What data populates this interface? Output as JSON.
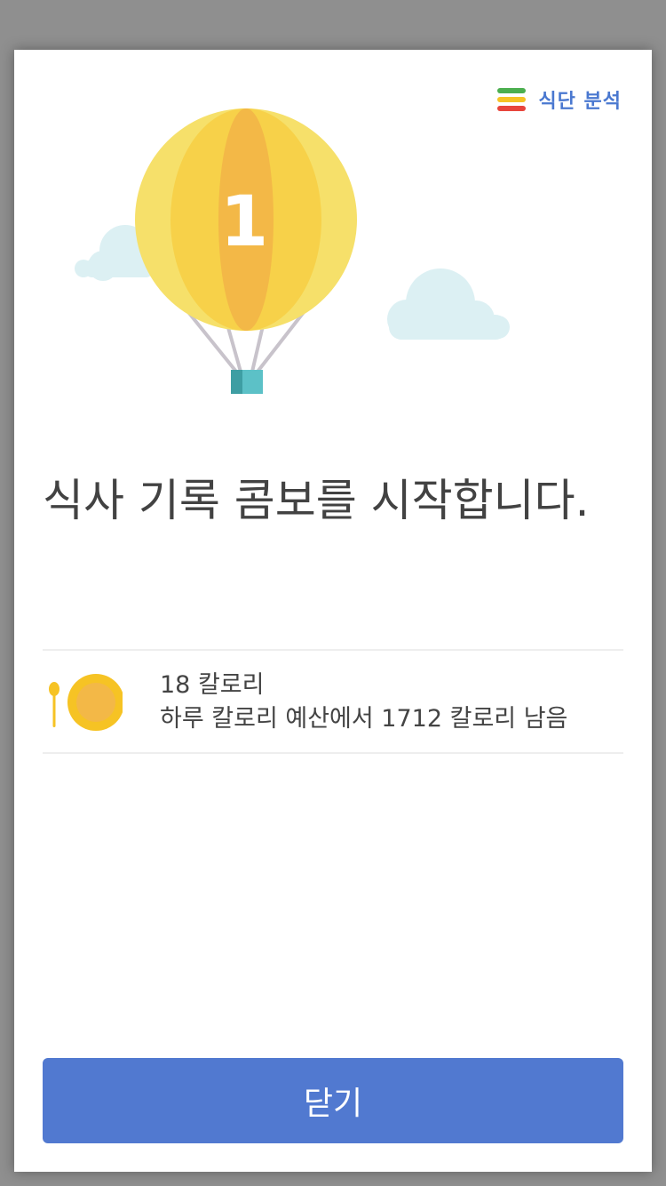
{
  "header": {
    "diet_link_label": "식단 분석",
    "diet_icon_colors": [
      "#4caf50",
      "#f6c324",
      "#e8453c"
    ]
  },
  "balloon": {
    "streak_number": "1"
  },
  "headline": "식사 기록 콤보를 시작합니다.",
  "summary": {
    "calories_line": "18 칼로리",
    "remaining_line": "하루 칼로리 예산에서 1712 칼로리 남음"
  },
  "close_button_label": "닫기",
  "colors": {
    "accent": "#5179d0",
    "balloon_light": "#f6e06a",
    "balloon_mid": "#f7d149",
    "balloon_core": "#f3b847",
    "cloud": "#dcf0f3",
    "basket": "#5cc1c7"
  }
}
